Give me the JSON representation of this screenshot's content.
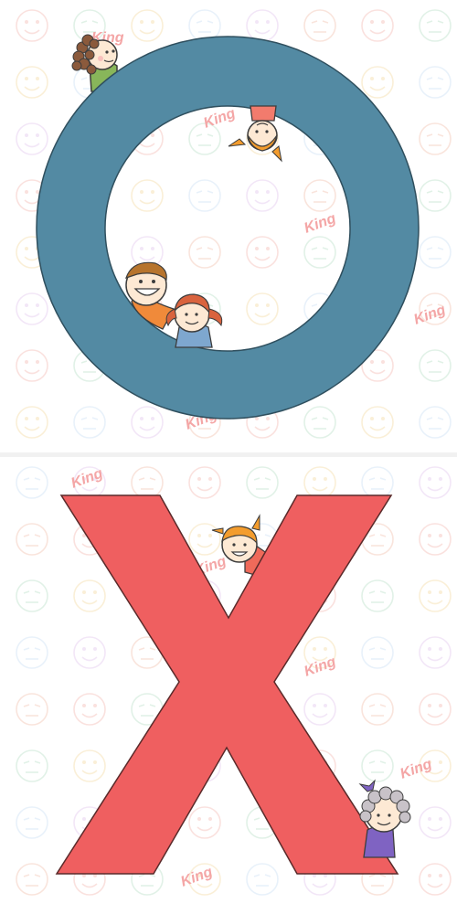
{
  "watermark": {
    "brand": "King",
    "colors": [
      "#f6c9c4",
      "#c9e7d4",
      "#f6e2b8",
      "#d6e6f6",
      "#e9d3f1",
      "#f5cfc0"
    ]
  },
  "cards": [
    {
      "symbol": "O",
      "symbol_name": "circle-o",
      "fill": "#538aa3",
      "stroke": "#2f4f5e",
      "characters": [
        "child-curly-hair",
        "child-orange-hair-upside-down",
        "child-smiling-boy",
        "child-girl-pigtails"
      ]
    },
    {
      "symbol": "X",
      "symbol_name": "cross-x",
      "fill": "#ef5f60",
      "stroke": "#5a2a2a",
      "characters": [
        "child-girl-orange-hair",
        "child-grey-hair-purple-bow"
      ]
    }
  ]
}
